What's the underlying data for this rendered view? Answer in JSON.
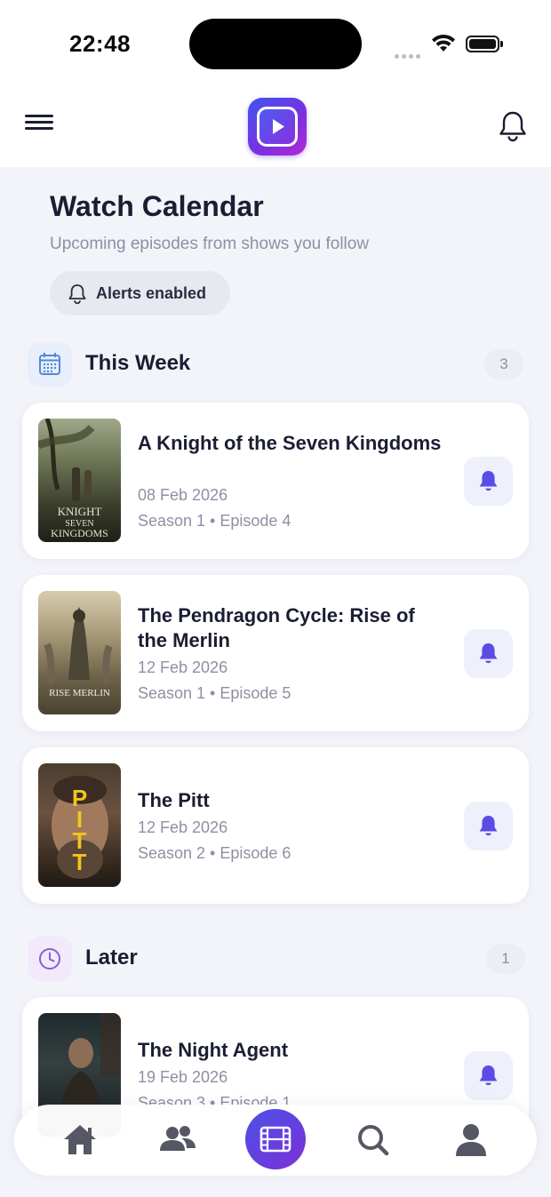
{
  "status_bar": {
    "time": "22:48"
  },
  "header": {
    "menu_icon": "hamburger-menu-icon",
    "logo_icon": "play-button-logo-icon",
    "notifications_icon": "bell-icon"
  },
  "hero": {
    "title": "Watch Calendar",
    "subtitle": "Upcoming episodes from shows you follow",
    "alerts_label": "Alerts enabled"
  },
  "sections": [
    {
      "title": "This Week",
      "count": "3",
      "icon": "calendar-icon",
      "items": [
        {
          "title": "A Knight of the Seven Kingdoms",
          "date": "08 Feb 2026",
          "episode": "Season 1 • Episode 4",
          "poster_text": "KNIGHT OF THE SEVEN KINGDOMS"
        },
        {
          "title": "The Pendragon Cycle: Rise of the Merlin",
          "date": "12 Feb 2026",
          "episode": "Season 1 • Episode 5",
          "poster_text": "RISE OF THE MERLIN"
        },
        {
          "title": "The Pitt",
          "date": "12 Feb 2026",
          "episode": "Season 2 • Episode 6",
          "poster_text": "THE PITT"
        }
      ]
    },
    {
      "title": "Later",
      "count": "1",
      "icon": "clock-icon",
      "items": [
        {
          "title": "The Night Agent",
          "date": "19 Feb 2026",
          "episode": "Season 3 • Episode 1"
        }
      ]
    }
  ],
  "tab_bar": {
    "tabs": [
      "home-icon",
      "friends-icon",
      "film-icon",
      "search-icon",
      "profile-icon"
    ],
    "active": "film-icon"
  },
  "colors": {
    "accent": "#5b4ce6",
    "background": "#f3f4fa",
    "text_primary": "#1b1d33",
    "text_secondary": "#8d90a3"
  }
}
